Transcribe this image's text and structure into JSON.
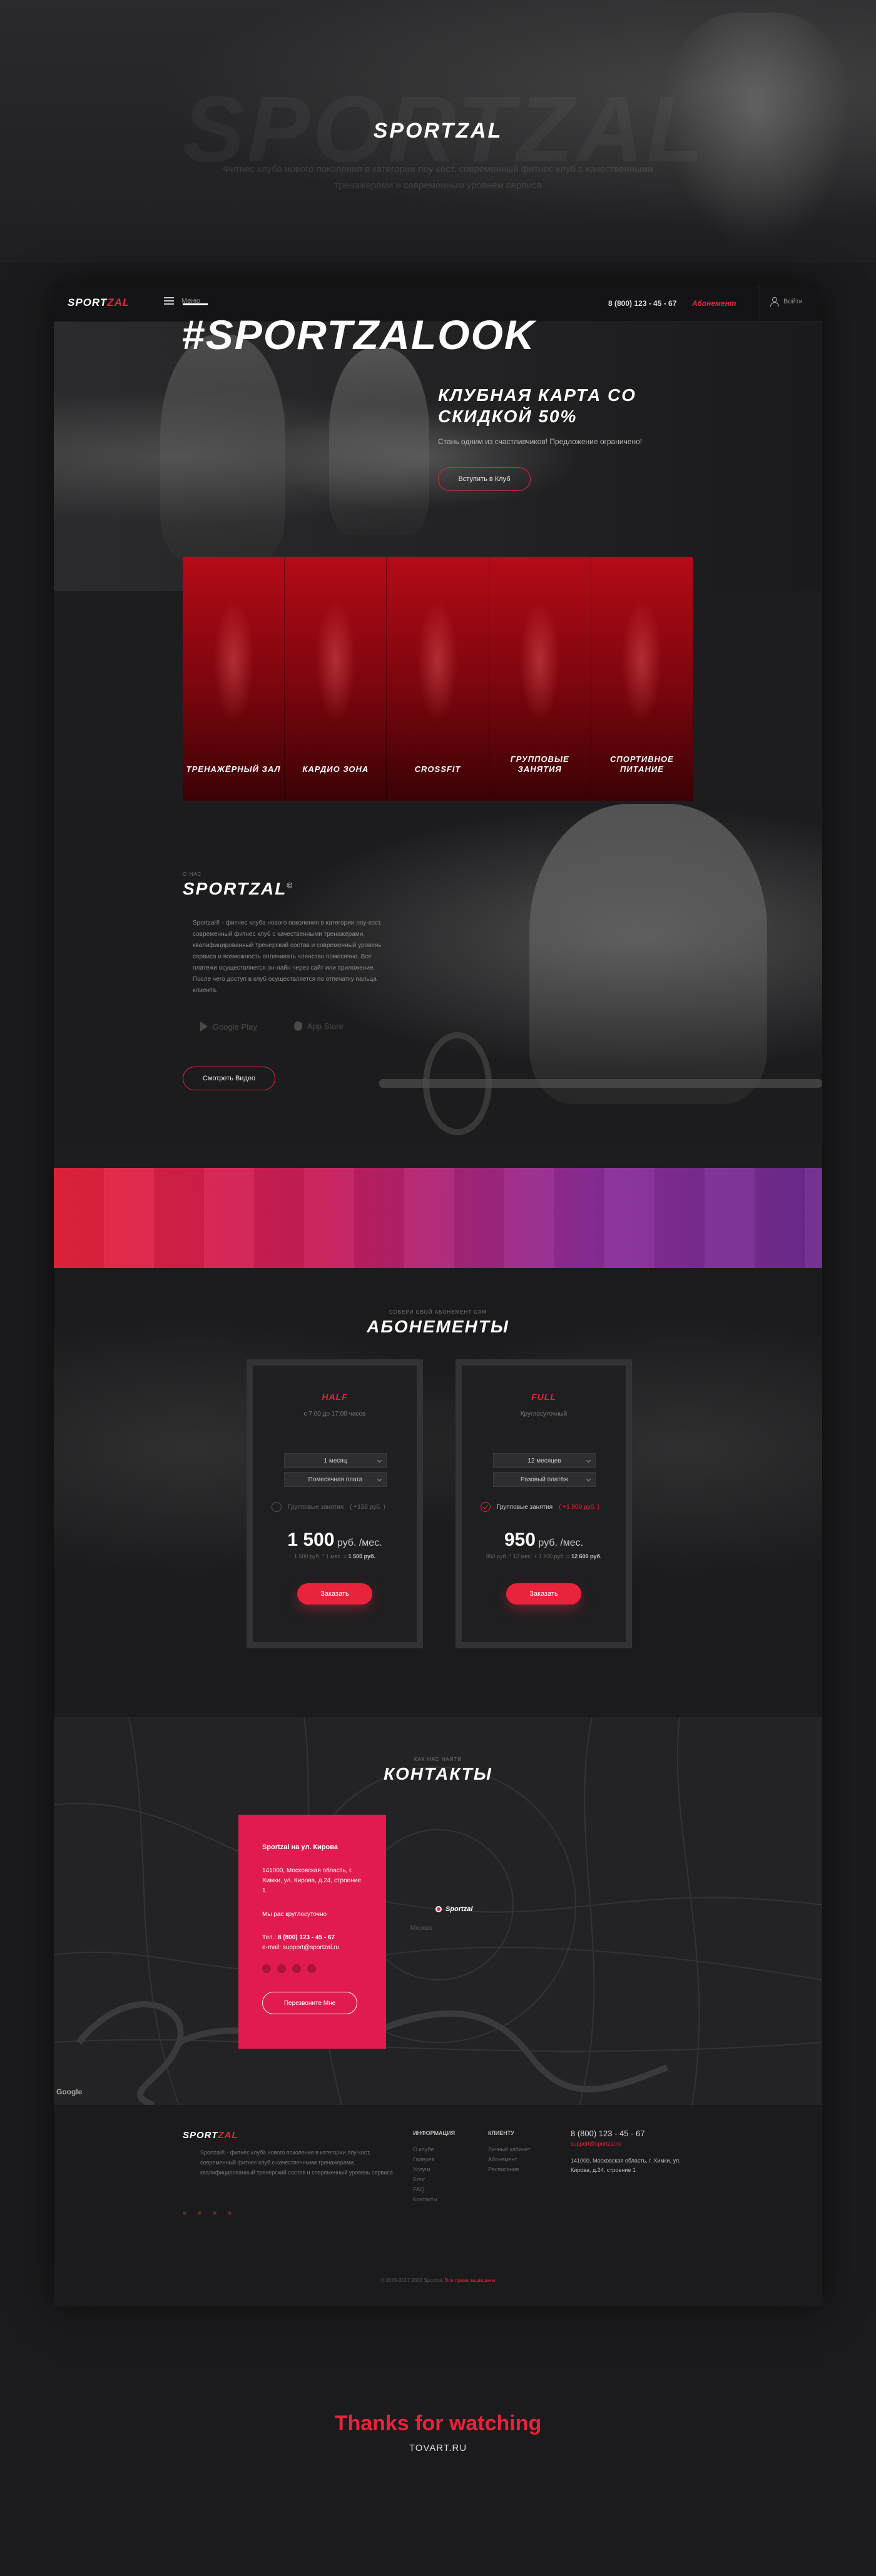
{
  "colors": {
    "accent": "#e8233b",
    "card_bg": "#e11b4f",
    "bg": "#1b1b1d"
  },
  "presentation": {
    "title": "SPORTZAL",
    "watermark": "SPORTZAL",
    "subtitle": "Фитнес клуба нового поколения в категории лоу-кост, современный фитнес клуб с качественными тренажерами и современным уровнем сервиса"
  },
  "nav": {
    "logo_main": "SPORT",
    "logo_accent": "ZAL",
    "menu_label": "Меню",
    "menu_icon": "burger-icon",
    "phone": "8 (800) 123 - 45 - 67",
    "subscription_link": "Абонемент",
    "login_label": "Войти",
    "login_icon": "user-icon"
  },
  "hero": {
    "title": "КЛУБНАЯ КАРТА СО СКИДКОЙ 50%",
    "text": "Стань одним из счастливчиков! Предложение ограничено!",
    "button": "Вступить в Клуб",
    "slides": 3,
    "active_slide": 1
  },
  "categories": [
    {
      "label": "ТРЕНАЖЁРНЫЙ ЗАЛ"
    },
    {
      "label": "КАРДИО ЗОНА"
    },
    {
      "label": "CROSSFIT"
    },
    {
      "label": "ГРУППОВЫЕ ЗАНЯТИЯ"
    },
    {
      "label": "СПОРТИВНОЕ ПИТАНИЕ"
    }
  ],
  "about": {
    "overline": "О НАС",
    "title": "SPORTZAL",
    "title_mark": "©",
    "text": "Sportzal® - фитнес клуба нового поколения в категории лоу-кост, современный фитнес клуб с качественными тренажерами, квалифицированный тренерский состав и современный уровень сервиса и возможность оплачивать членство помесячно. Все платежи осуществляется он-лайн через сайт или приложение. После чего доступ в клуб осуществляется по отпечатку пальца клиента.",
    "google_play": "Google Play",
    "app_store": "App Store",
    "button": "Смотреть Видео"
  },
  "hashtag": "#SPORTZALOOK",
  "subscriptions": {
    "overline": "СОБЕРИ СВОЙ АБОНЕМЕНТ САМ",
    "title": "АБОНЕМЕНТЫ",
    "plans": [
      {
        "name": "HALF",
        "time": "с 7:00 до 17:00 часов",
        "duration": "1 месяц",
        "payment": "Помесячная плата",
        "group_label": "Групповые занятия",
        "group_extra": "( +150 руб. )",
        "group_checked": false,
        "price": "1 500",
        "unit": "руб. /мес.",
        "calc": "1 500 руб. * 1 мес. = ",
        "calc_total": "1 500 руб.",
        "button": "Заказать"
      },
      {
        "name": "FULL",
        "time": "Круглосуточный",
        "duration": "12 месяцев",
        "payment": "Разовый платёж",
        "group_label": "Групповые занятия",
        "group_extra": "( +1 800 руб. )",
        "group_checked": true,
        "price": "950",
        "unit": "руб. /мес.",
        "calc": "950 руб. * 12 мес. + 1 200 руб. = ",
        "calc_total": "12 600 руб.",
        "button": "Заказать"
      }
    ]
  },
  "contacts": {
    "overline": "КАК НАС НАЙТИ",
    "title": "КОНТАКТЫ",
    "card_title": "Sportzal на ул. Кирова",
    "address": "141000, Московская область, г. Химки, ул. Кирова, д.24, строение 1",
    "hours": "Мы рас круглосуточно",
    "tel_label": "Тел.: ",
    "tel": "8 (800) 123 - 45 - 67",
    "email_label": "e-mail: ",
    "email": "support@sportzal.ru",
    "button": "Перезвоните Мне",
    "map_pin": "Sportzal",
    "map_city": "Москва",
    "google": "Google"
  },
  "footer": {
    "logo_main": "SPORT",
    "logo_accent": "ZAL",
    "about": "Sportzal® - фитнес клуба нового поколения в категории лоу-кост, современный фитнес клуб с качественными тренажерами, квалифицированный тренерский состав и современный уровень сервиса",
    "info_heading": "ИНФОРМАЦИЯ",
    "info_links": [
      "О клубе",
      "Галерея",
      "Услуги",
      "Блог",
      "FAQ",
      "Контакты"
    ],
    "client_heading": "КЛИЕНТУ",
    "client_links": [
      "Личный кабинет",
      "Абонемент",
      "Расписание"
    ],
    "phone": "8 (800) 123 - 45 - 67",
    "email": "support@sportzal.ru",
    "address": "141000, Московская область, г. Химки, ул. Кирова, д.24, строение 1",
    "copyright": "© 2015-2017 2022 Sportzal. ",
    "copyright_link": "Все права защищены"
  },
  "thanks": {
    "title": "Thanks for watching",
    "site": "TOVART.RU"
  }
}
